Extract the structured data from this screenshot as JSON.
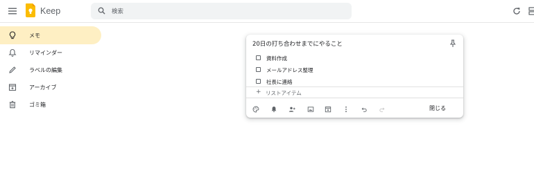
{
  "header": {
    "app_name": "Keep",
    "search_placeholder": "検索"
  },
  "sidebar": {
    "items": [
      {
        "label": "メモ",
        "icon": "lightbulb-icon",
        "active": true
      },
      {
        "label": "リマインダー",
        "icon": "bell-icon",
        "active": false
      },
      {
        "label": "ラベルの編集",
        "icon": "pencil-icon",
        "active": false
      },
      {
        "label": "アーカイブ",
        "icon": "archive-icon",
        "active": false
      },
      {
        "label": "ゴミ箱",
        "icon": "trash-icon",
        "active": false
      }
    ]
  },
  "note": {
    "title": "20日の打ち合わせまでにやること",
    "items": [
      {
        "text": "資料作成",
        "checked": false
      },
      {
        "text": "メールアドレス整理",
        "checked": false
      },
      {
        "text": "社長に連絡",
        "checked": false
      }
    ],
    "add_item_placeholder": "リストアイテム",
    "close_label": "閉じる",
    "toolbar": [
      "palette-icon",
      "reminder-icon",
      "collaborator-icon",
      "image-icon",
      "archive-icon",
      "more-icon",
      "undo-icon",
      "redo-icon"
    ]
  },
  "colors": {
    "active_nav": "#feefc3",
    "logo_yellow": "#fbbc04",
    "search_bg": "#f1f3f4"
  }
}
